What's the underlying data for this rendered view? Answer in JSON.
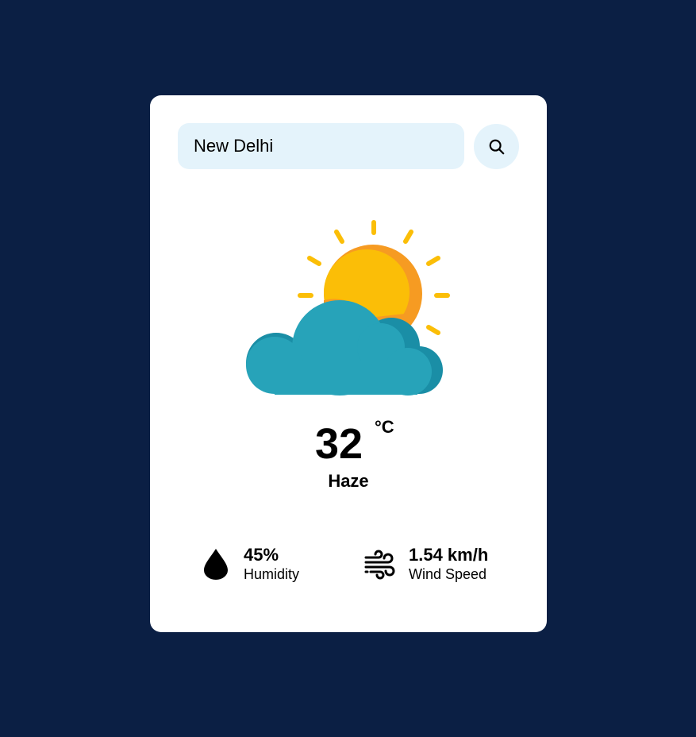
{
  "search": {
    "value": "New Delhi",
    "placeholder": "",
    "button_icon": "search-icon"
  },
  "weather": {
    "icon": "sun-behind-cloud-icon",
    "temperature": "32",
    "unit": "°C",
    "condition": "Haze"
  },
  "stats": {
    "humidity": {
      "value": "45%",
      "label": "Humidity",
      "icon": "water-drop-icon"
    },
    "wind": {
      "value": "1.54 km/h",
      "label": "Wind Speed",
      "icon": "wind-icon"
    }
  },
  "colors": {
    "background": "#0b1f44",
    "card": "#ffffff",
    "input": "#e4f3fb",
    "sun": "#fbbe07",
    "sun_shade": "#f69b22",
    "cloud": "#27a3b9",
    "cloud_shade": "#1a8ea6"
  }
}
